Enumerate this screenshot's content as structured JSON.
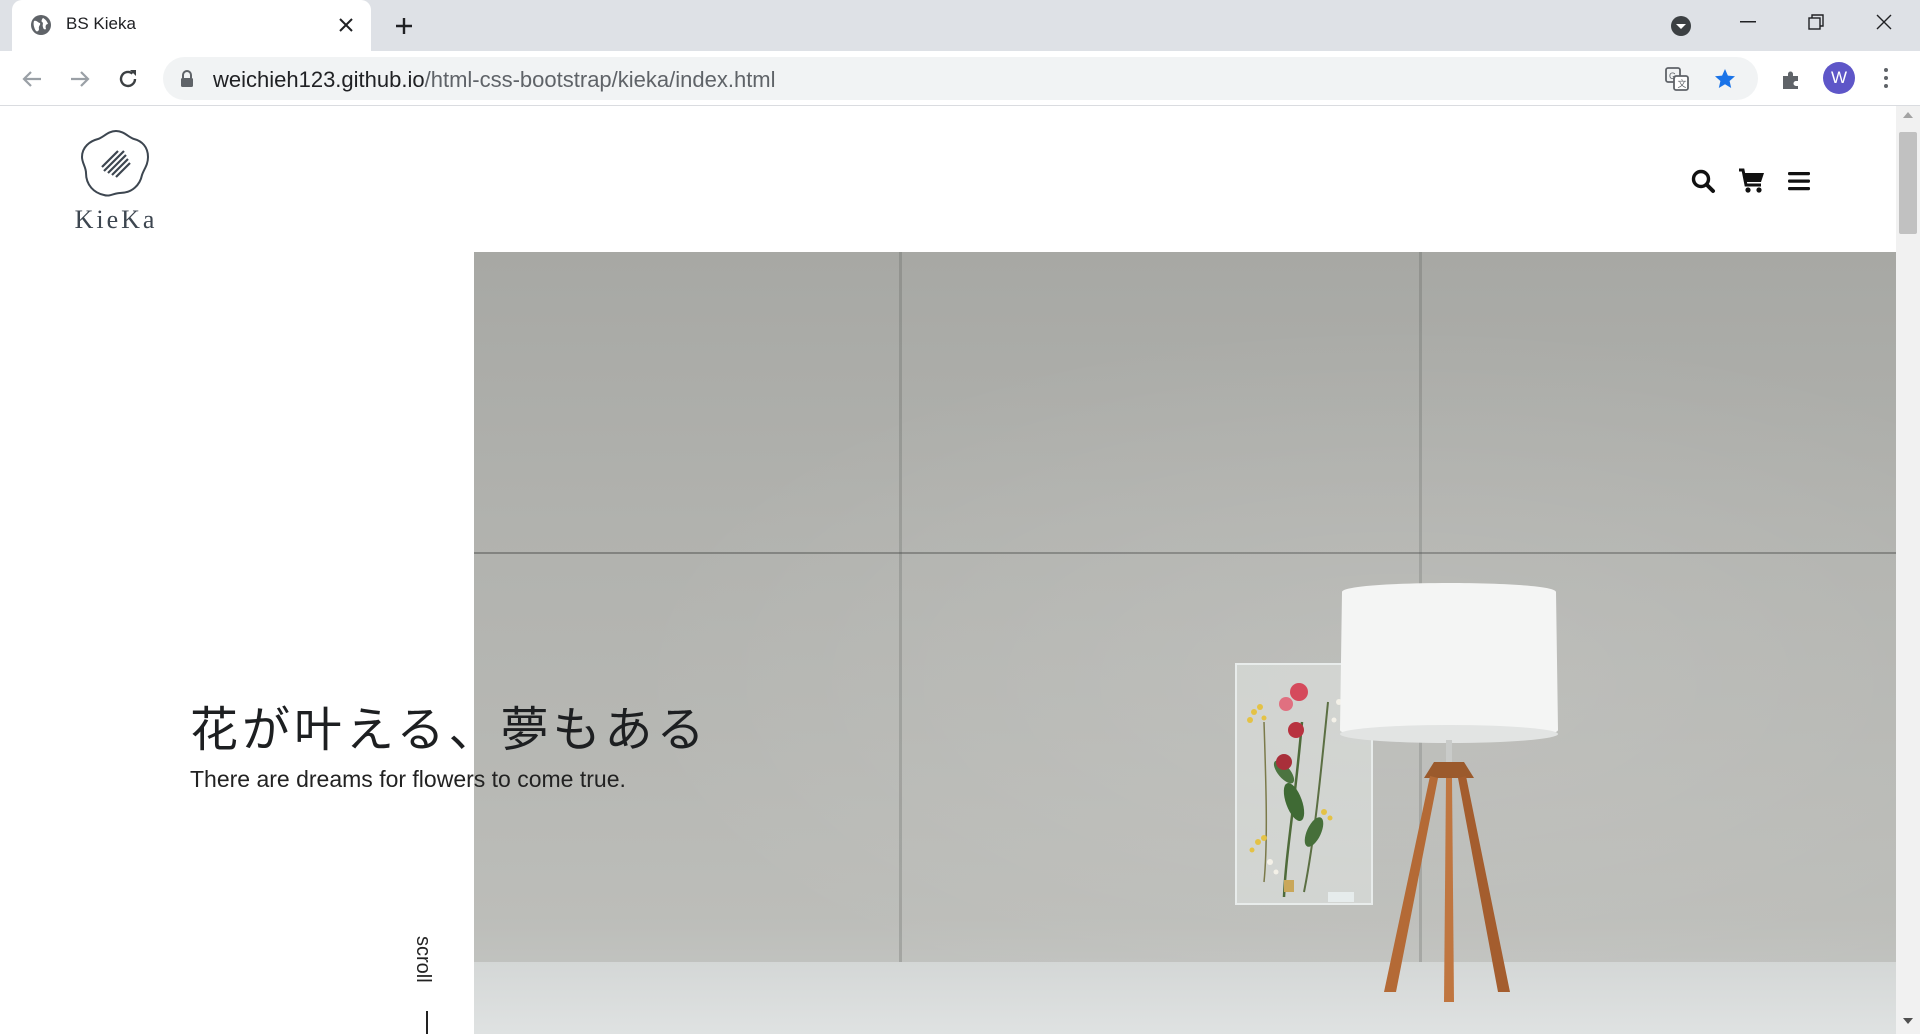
{
  "browser": {
    "tab_title": "BS Kieka",
    "url_host": "weichieh123.github.io",
    "url_path": "/html-css-bootstrap/kieka/index.html",
    "profile_initial": "W",
    "colors": {
      "avatar": "#5e56c8",
      "star": "#1a73e8"
    }
  },
  "site": {
    "logo_text": "KieKa",
    "header_icons": [
      "search-icon",
      "cart-icon",
      "menu-icon"
    ],
    "hero": {
      "title": "花が叶える、夢もある",
      "subtitle": "There are dreams for flowers to come true."
    },
    "scroll_label": "scroll"
  }
}
